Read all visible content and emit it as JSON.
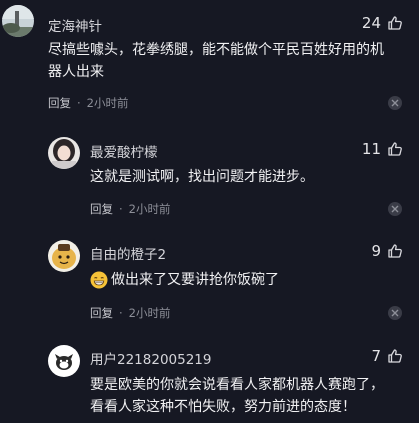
{
  "comments": [
    {
      "username": "定海神针",
      "likes": "24",
      "text_lines": [
        "尽搞些噱头，花拳绣腿，能不能做个平民百姓好用的机",
        "器人出来"
      ],
      "reply_label": "回复",
      "time": "2小时前",
      "avatar": "landscape-avatar"
    },
    {
      "username": "最爱酸柠檬",
      "likes": "11",
      "text_lines": [
        "这就是测试啊，找出问题才能进步。"
      ],
      "reply_label": "回复",
      "time": "2小时前",
      "avatar": "girl-avatar"
    },
    {
      "username": "自由的橙子2",
      "likes": "9",
      "text_lines": [
        "做出来了又要讲抢你饭碗了"
      ],
      "reply_label": "回复",
      "time": "2小时前",
      "avatar": "cartoon-avatar",
      "emoji": "grin-emoji"
    },
    {
      "username": "用户22182005219",
      "likes": "7",
      "text_lines": [
        "要是欧美的你就会说看看人家都机器人赛跑了，",
        "看看人家这种不怕失败，努力前进的态度！"
      ],
      "avatar": "default-avatar"
    }
  ],
  "colors": {
    "background": "#161823",
    "text": "#f1f1f3",
    "muted": "#8d8f98"
  }
}
